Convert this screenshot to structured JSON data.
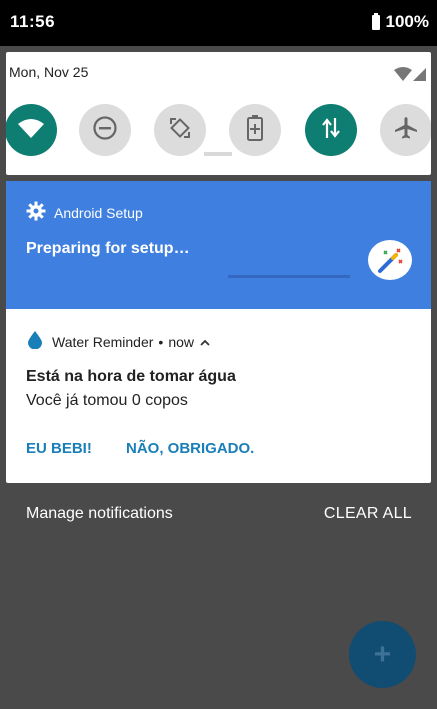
{
  "status_bar": {
    "time": "11:56",
    "battery": "100%"
  },
  "quick_settings": {
    "date": "Mon, Nov 25",
    "tiles": [
      {
        "icon": "wifi-icon",
        "active": true
      },
      {
        "icon": "do-not-disturb-icon",
        "active": false
      },
      {
        "icon": "auto-rotate-icon",
        "active": false
      },
      {
        "icon": "battery-saver-icon",
        "active": false
      },
      {
        "icon": "mobile-data-icon",
        "active": true
      },
      {
        "icon": "airplane-mode-icon",
        "active": false
      }
    ]
  },
  "setup_notification": {
    "app": "Android Setup",
    "title": "Preparing for setup…"
  },
  "water_notification": {
    "app": "Water Reminder",
    "separator": "•",
    "time": "now",
    "title": "Está na hora de tomar água",
    "text": "Você já tomou 0 copos",
    "action_yes": "EU BEBI!",
    "action_no": "NÃO, OBRIGADO."
  },
  "footer": {
    "manage": "Manage notifications",
    "clear": "CLEAR ALL"
  },
  "fab": {
    "label": "+"
  },
  "colors": {
    "accent_teal": "#0f7e72",
    "setup_blue": "#3f7fdf",
    "action_blue": "#1a7fb8"
  }
}
